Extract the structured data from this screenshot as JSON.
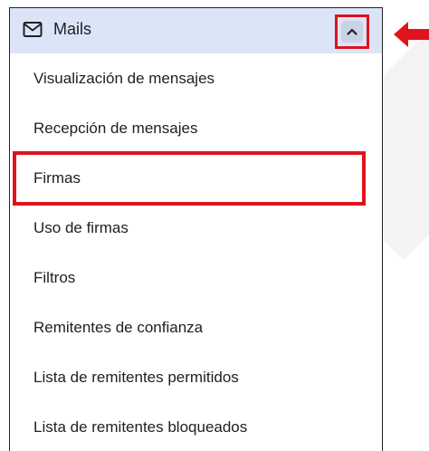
{
  "colors": {
    "accent_red": "#e0131c",
    "header_bg": "#dbe5f7",
    "text": "#202124"
  },
  "header": {
    "icon": "mail-icon",
    "label": "Mails",
    "toggle_icon": "chevron-up-icon"
  },
  "menu": {
    "items": [
      "Visualización de mensajes",
      "Recepción de mensajes",
      "Firmas",
      "Uso de firmas",
      "Filtros",
      "Remitentes de confianza",
      "Lista de remitentes permitidos",
      "Lista de remitentes bloqueados"
    ],
    "highlighted_item": "Firmas"
  },
  "annotations": {
    "arrow_icon": "arrow-left-icon"
  }
}
